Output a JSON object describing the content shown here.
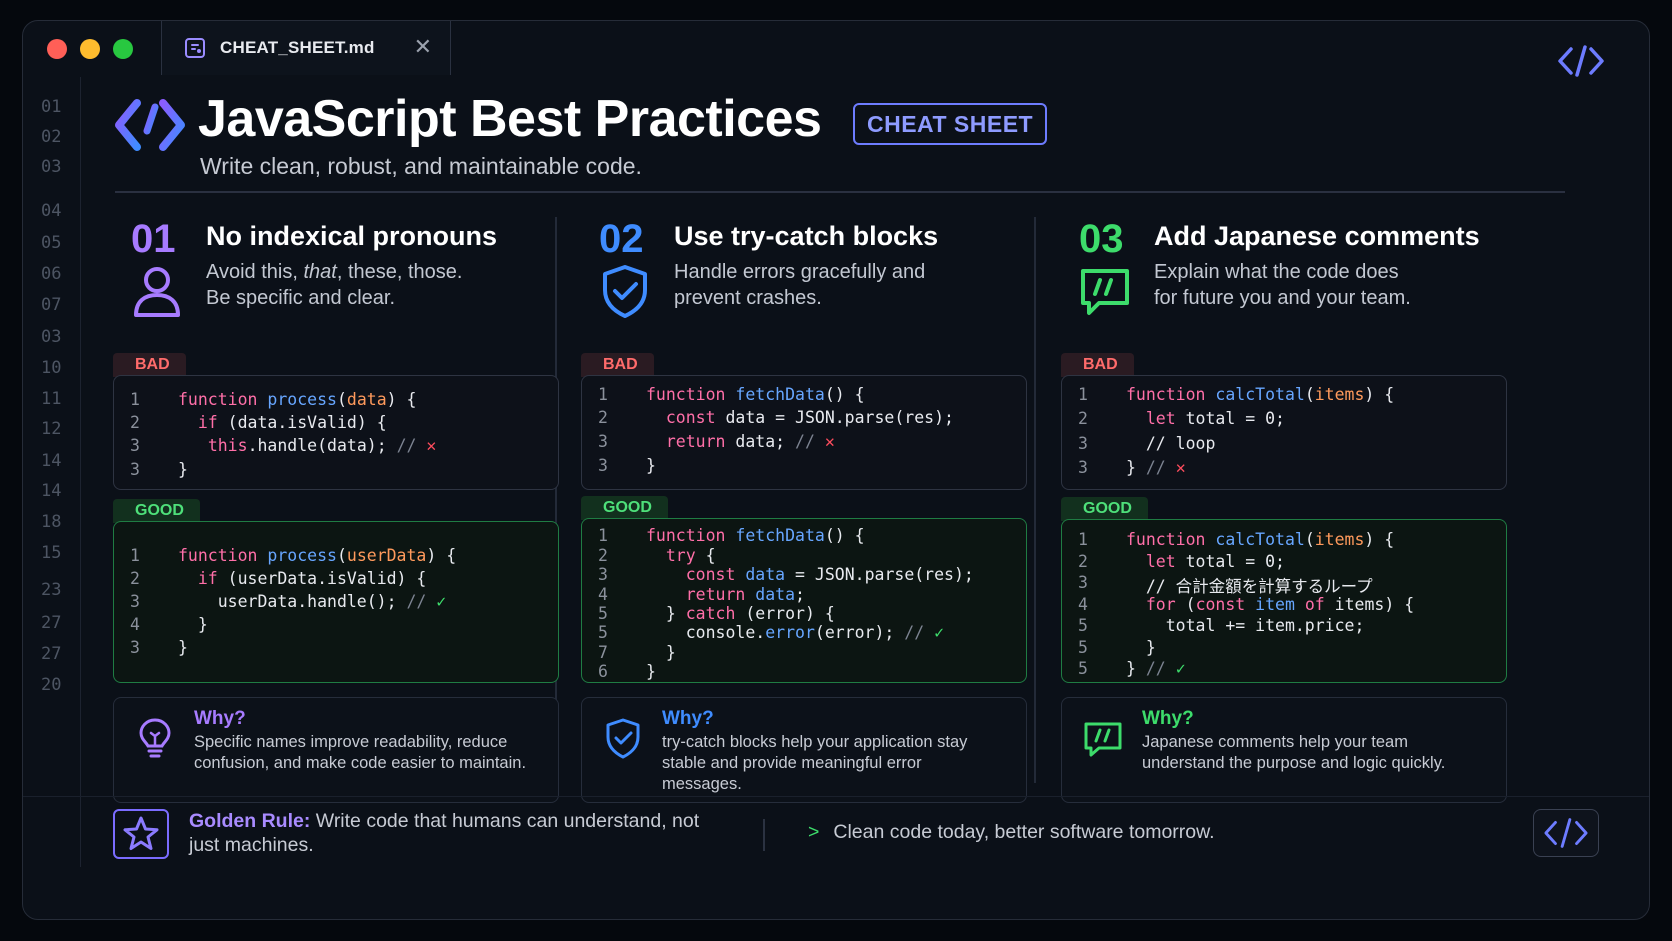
{
  "window": {
    "tab_label": "CHEAT_SHEET.md",
    "close_glyph": "✕"
  },
  "gutter": [
    "01",
    "02",
    "03",
    "04",
    "05",
    "06",
    "07",
    "03",
    "10",
    "11",
    "12",
    "14",
    "14",
    "18",
    "15",
    "23",
    "27",
    "27",
    "20"
  ],
  "header": {
    "title": "JavaScript Best Practices",
    "badge": "CHEAT SHEET",
    "subtitle": "Write clean, robust, and maintainable code."
  },
  "columns": [
    {
      "num": "01",
      "accent": "#a77bff",
      "title": "No indexical pronouns",
      "desc_line1_pre": "Avoid this, ",
      "desc_line1_em": "that",
      "desc_line1_post": ", these, those.",
      "desc_line2": "Be specific and clear.",
      "icon": "user-icon",
      "bad_label": "BAD",
      "good_label": "GOOD",
      "bad_ln": [
        "1",
        "2",
        "3",
        "3"
      ],
      "good_ln": [
        "1",
        "2",
        "3",
        "4",
        "3"
      ],
      "why_title": "Why?",
      "why_text": "Specific names improve readability, reduce confusion, and make code easier to maintain.",
      "why_icon": "lightbulb-icon"
    },
    {
      "num": "02",
      "accent": "#3f8cff",
      "title": "Use try-catch blocks",
      "desc_line1": "Handle errors gracefully and",
      "desc_line2": "prevent crashes.",
      "icon": "shield-check-icon",
      "bad_label": "BAD",
      "good_label": "GOOD",
      "bad_ln": [
        "1",
        "2",
        "3",
        "3"
      ],
      "good_ln": [
        "1",
        "2",
        "3",
        "4",
        "5",
        "5",
        "7",
        "6"
      ],
      "why_title": "Why?",
      "why_text": "try-catch blocks help your application stay stable and provide meaningful error messages.",
      "why_icon": "shield-icon"
    },
    {
      "num": "03",
      "accent": "#3ddc6b",
      "title": "Add Japanese comments",
      "desc_line1": "Explain what the code does",
      "desc_line2": "for future you and your team.",
      "icon": "comment-icon",
      "bad_label": "BAD",
      "good_label": "GOOD",
      "bad_ln": [
        "1",
        "2",
        "3",
        "3"
      ],
      "good_ln": [
        "1",
        "2",
        "3",
        "4",
        "5",
        "5",
        "5"
      ],
      "why_title": "Why?",
      "why_text": "Japanese comments help your team understand the purpose and logic quickly.",
      "why_icon": "comment-icon"
    }
  ],
  "code": {
    "c1_bad_1": [
      "function ",
      "process",
      "(",
      "data",
      ") {"
    ],
    "c1_bad_2": [
      "  if (data.isValid) {"
    ],
    "c1_bad_3": [
      "   ",
      "this",
      ".handle(data); ",
      "// "
    ],
    "c1_bad_4": [
      "}"
    ],
    "c1_good_1": [
      "function ",
      "process",
      "(",
      "userData",
      ") {"
    ],
    "c1_good_2": [
      "  if (userData.isValid) {"
    ],
    "c1_good_3": [
      "    userData.handle(); ",
      "// "
    ],
    "c1_good_4": [
      "  }"
    ],
    "c1_good_5": [
      "}"
    ],
    "c2_bad_1": [
      "function ",
      "fetchData",
      "() {"
    ],
    "c2_bad_2": [
      "  ",
      "const",
      " data = JSON.parse(res);"
    ],
    "c2_bad_3": [
      "  ",
      "return",
      " data; ",
      "// "
    ],
    "c2_bad_4": [
      "}"
    ],
    "c2_good_1": [
      "function ",
      "fetchData",
      "() {"
    ],
    "c2_good_2": [
      "  ",
      "try",
      " {"
    ],
    "c2_good_3": [
      "    ",
      "const",
      " ",
      "data",
      " = JSON.parse(res);"
    ],
    "c2_good_4": [
      "    ",
      "return",
      " ",
      "data",
      ";"
    ],
    "c2_good_5": [
      "  } ",
      "catch",
      " (error) {"
    ],
    "c2_good_6": [
      "    console.",
      "error",
      "(error); ",
      "// "
    ],
    "c2_good_7": [
      "  }"
    ],
    "c2_good_8": [
      "}"
    ],
    "c3_bad_1": [
      "function ",
      "calcTotal",
      "(",
      "items",
      ") {"
    ],
    "c3_bad_2": [
      "  ",
      "let",
      " total = 0;"
    ],
    "c3_bad_3": [
      "  // loop"
    ],
    "c3_bad_4": [
      "} ",
      "// "
    ],
    "c3_good_1": [
      "function ",
      "calcTotal",
      "(",
      "items",
      ") {"
    ],
    "c3_good_2": [
      "  ",
      "let",
      " total = 0;"
    ],
    "c3_good_3": [
      "  // 合計金額を計算するループ"
    ],
    "c3_good_4": [
      "  ",
      "for",
      " (",
      "const",
      " ",
      "item",
      " ",
      "of",
      " items) {"
    ],
    "c3_good_5": [
      "    total += item.price;"
    ],
    "c3_good_6": [
      "  }"
    ],
    "c3_good_7": [
      "} ",
      "// "
    ]
  },
  "marks": {
    "x": "✕",
    "check": "✓"
  },
  "footer": {
    "golden_label": "Golden Rule:",
    "golden_text": " Write code that humans can understand, not just machines.",
    "prompt_chevron": ">",
    "prompt_text": "Clean code today, better software tomorrow."
  }
}
